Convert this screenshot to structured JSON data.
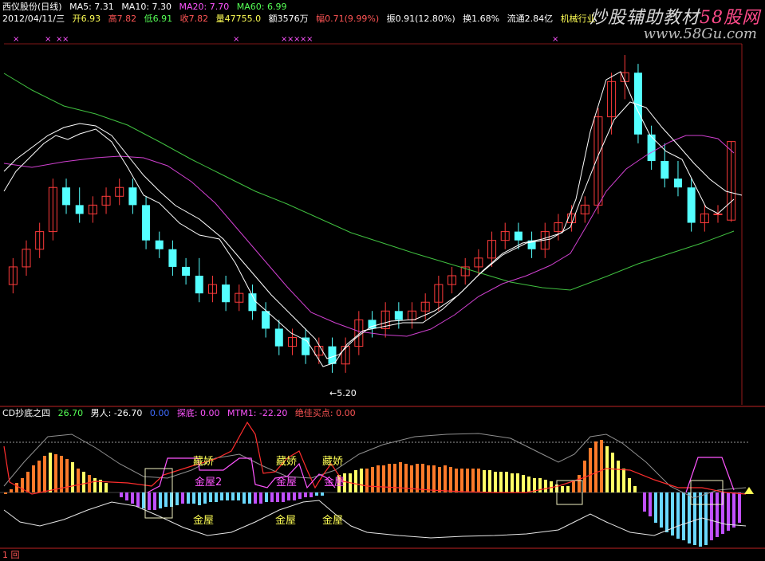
{
  "header": {
    "stock_name": "西仪股份(日线)",
    "ma5": "MA5: 7.31",
    "ma10": "MA10: 7.30",
    "ma20": "MA20: 7.70",
    "ma60": "MA60: 6.99",
    "date": "2012/04/11/三",
    "open": "开6.93",
    "high": "高7.82",
    "low": "低6.91",
    "close": "收7.82",
    "volume": "量47755.0",
    "amount": "额3576万",
    "change": "幅0.71(9.99%)",
    "amplitude": "振0.91(12.80%)",
    "turnover": "换1.68%",
    "float_cap": "流通2.84亿",
    "industry": "机械行业"
  },
  "watermark": {
    "line1": "炒股辅助教材",
    "line1_mark": "58股网",
    "line2": "www.58Gu.com"
  },
  "indicator": {
    "name": "CD抄底之四",
    "v1": "26.70",
    "v2": "男人: -26.70",
    "v3": "0.00",
    "v4": "探底: 0.00",
    "v5": "MTM1: -22.20",
    "v6": "绝佳买点: 0.00"
  },
  "annotations": {
    "low_price": "←5.20",
    "cangjiao": "藏娇",
    "jinwu": "金屋",
    "jinwu2": "金屋2"
  },
  "bottom": {
    "text": "1 回"
  },
  "colors": {
    "up": "#ff3b3b",
    "down": "#54ffff",
    "ma5": "#ffffff",
    "ma10": "#ffffff",
    "ma20": "#d040d0",
    "ma60": "#40c040",
    "hist_pos_a": "#ff7a2a",
    "hist_pos_b": "#ffff66",
    "hist_neg_a": "#c050ff",
    "hist_neg_b": "#6ad8ff"
  },
  "chart_data": {
    "type": "candlestick",
    "ohlc_estimated": [
      [
        6.2,
        6.5,
        6.1,
        6.4
      ],
      [
        6.4,
        6.7,
        6.3,
        6.6
      ],
      [
        6.6,
        6.9,
        6.5,
        6.8
      ],
      [
        6.8,
        7.4,
        6.7,
        7.3
      ],
      [
        7.3,
        7.4,
        7.0,
        7.1
      ],
      [
        7.1,
        7.3,
        6.9,
        7.0
      ],
      [
        7.0,
        7.2,
        6.9,
        7.1
      ],
      [
        7.1,
        7.3,
        7.0,
        7.2
      ],
      [
        7.2,
        7.4,
        7.1,
        7.3
      ],
      [
        7.3,
        7.4,
        7.0,
        7.1
      ],
      [
        7.1,
        7.2,
        6.6,
        6.7
      ],
      [
        6.7,
        6.8,
        6.5,
        6.6
      ],
      [
        6.6,
        6.7,
        6.3,
        6.4
      ],
      [
        6.4,
        6.5,
        6.2,
        6.3
      ],
      [
        6.3,
        6.5,
        6.0,
        6.1
      ],
      [
        6.1,
        6.3,
        6.0,
        6.2
      ],
      [
        6.2,
        6.3,
        5.9,
        6.0
      ],
      [
        6.0,
        6.2,
        5.9,
        6.1
      ],
      [
        6.1,
        6.2,
        5.8,
        5.9
      ],
      [
        5.9,
        6.0,
        5.6,
        5.7
      ],
      [
        5.7,
        5.8,
        5.4,
        5.5
      ],
      [
        5.5,
        5.7,
        5.4,
        5.6
      ],
      [
        5.6,
        5.7,
        5.3,
        5.4
      ],
      [
        5.4,
        5.6,
        5.3,
        5.5
      ],
      [
        5.5,
        5.6,
        5.2,
        5.3
      ],
      [
        5.3,
        5.6,
        5.2,
        5.5
      ],
      [
        5.5,
        5.9,
        5.4,
        5.8
      ],
      [
        5.8,
        5.9,
        5.6,
        5.7
      ],
      [
        5.7,
        6.0,
        5.6,
        5.9
      ],
      [
        5.9,
        6.0,
        5.7,
        5.8
      ],
      [
        5.8,
        6.0,
        5.7,
        5.9
      ],
      [
        5.9,
        6.1,
        5.8,
        6.0
      ],
      [
        6.0,
        6.3,
        5.9,
        6.2
      ],
      [
        6.2,
        6.4,
        6.1,
        6.3
      ],
      [
        6.3,
        6.5,
        6.2,
        6.4
      ],
      [
        6.4,
        6.6,
        6.3,
        6.5
      ],
      [
        6.5,
        6.8,
        6.4,
        6.7
      ],
      [
        6.7,
        6.9,
        6.6,
        6.8
      ],
      [
        6.8,
        6.9,
        6.6,
        6.7
      ],
      [
        6.7,
        6.8,
        6.5,
        6.6
      ],
      [
        6.6,
        6.9,
        6.5,
        6.8
      ],
      [
        6.8,
        7.0,
        6.7,
        6.9
      ],
      [
        6.9,
        7.1,
        6.8,
        7.0
      ],
      [
        7.0,
        7.2,
        6.9,
        7.1
      ],
      [
        7.1,
        8.2,
        7.0,
        8.1
      ],
      [
        8.1,
        8.6,
        7.9,
        8.5
      ],
      [
        8.5,
        8.8,
        8.3,
        8.6
      ],
      [
        8.6,
        8.7,
        7.8,
        7.9
      ],
      [
        7.9,
        8.0,
        7.5,
        7.6
      ],
      [
        7.6,
        7.8,
        7.3,
        7.4
      ],
      [
        7.4,
        7.6,
        7.2,
        7.3
      ],
      [
        7.3,
        7.4,
        6.8,
        6.9
      ],
      [
        6.9,
        7.1,
        6.8,
        7.0
      ],
      [
        7.0,
        7.1,
        6.9,
        7.0
      ],
      [
        6.93,
        7.82,
        6.91,
        7.82
      ]
    ],
    "low_marker": 5.2,
    "ma20_last": 7.7,
    "ma60_last": 6.99,
    "ma5_last": 7.31,
    "ma10_last": 7.3
  }
}
